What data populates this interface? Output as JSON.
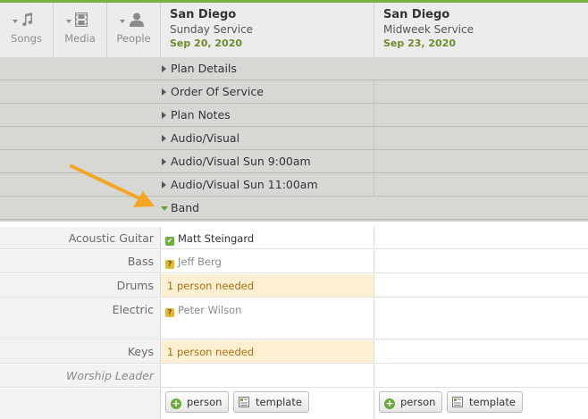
{
  "toolbar": {
    "tools": [
      {
        "label": "Songs",
        "icon": "music-note-icon"
      },
      {
        "label": "Media",
        "icon": "film-icon"
      },
      {
        "label": "People",
        "icon": "person-icon"
      }
    ]
  },
  "plans": [
    {
      "location": "San Diego",
      "service": "Sunday Service",
      "date": "Sep 20, 2020"
    },
    {
      "location": "San Diego",
      "service": "Midweek Service",
      "date": "Sep 23, 2020"
    }
  ],
  "sections": [
    {
      "label": "Plan Details",
      "expanded": false
    },
    {
      "label": "Order Of Service",
      "expanded": false
    },
    {
      "label": "Plan Notes",
      "expanded": false
    },
    {
      "label": "Audio/Visual",
      "expanded": false
    },
    {
      "label": "Audio/Visual Sun 9:00am",
      "expanded": false
    },
    {
      "label": "Audio/Visual Sun 11:00am",
      "expanded": false
    },
    {
      "label": "Band",
      "expanded": true
    }
  ],
  "band": {
    "positions": [
      {
        "label": "Acoustic Guitar",
        "status": "confirmed",
        "person": "Matt Steingard",
        "status_symbol": "✔"
      },
      {
        "label": "Bass",
        "status": "unconfirmed",
        "person": "Jeff Berg",
        "status_symbol": "?"
      },
      {
        "label": "Drums",
        "status": "needed",
        "needed_text": "1 person needed"
      },
      {
        "label": "Electric",
        "status": "unconfirmed",
        "person": "Peter Wilson",
        "status_symbol": "?"
      },
      {
        "label": "Keys",
        "status": "needed",
        "needed_text": "1 person needed"
      },
      {
        "label": "Worship Leader",
        "status": "empty"
      }
    ],
    "add_person_label": "person",
    "add_template_label": "template"
  },
  "colors": {
    "accent_green": "#7db043",
    "date_green": "#6f8b2b",
    "needed_bg": "#fdf0d2",
    "needed_text": "#b26d12",
    "annotation_arrow": "#f5a623"
  }
}
